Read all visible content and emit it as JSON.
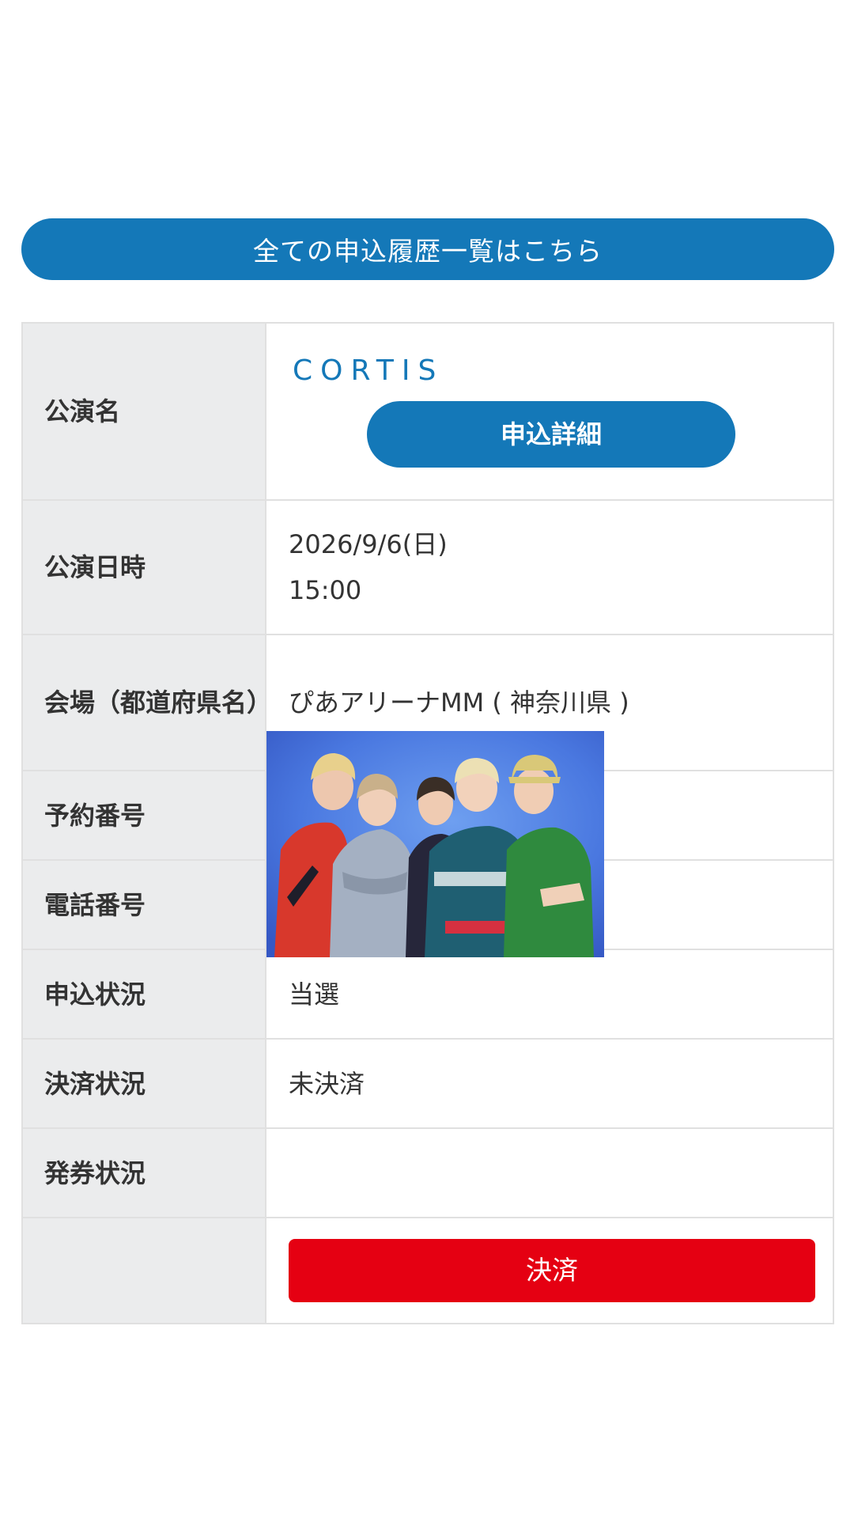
{
  "history_button": {
    "label": "全ての申込履歴一覧はこちら"
  },
  "table": {
    "performance": {
      "label": "公演名",
      "artist": "CORTIS",
      "detail_button": "申込詳細"
    },
    "datetime": {
      "label": "公演日時",
      "date": "2026/9/6(日)",
      "time": "15:00"
    },
    "venue": {
      "label": "会場（都道府県名）",
      "value": "ぴあアリーナMM ( 神奈川県 )"
    },
    "reservation_no": {
      "label": "予約番号",
      "value": ""
    },
    "phone_no": {
      "label": "電話番号",
      "value": ""
    },
    "application_status": {
      "label": "申込状況",
      "value": "当選"
    },
    "payment_status": {
      "label": "決済状況",
      "value": "未決済"
    },
    "ticketing_status": {
      "label": "発券状況",
      "value": ""
    },
    "pay_button": "決済"
  },
  "colors": {
    "accent": "#1478b8",
    "pay": "#e50012",
    "unpaid": "#e0457b",
    "label_bg": "#ebeced"
  }
}
